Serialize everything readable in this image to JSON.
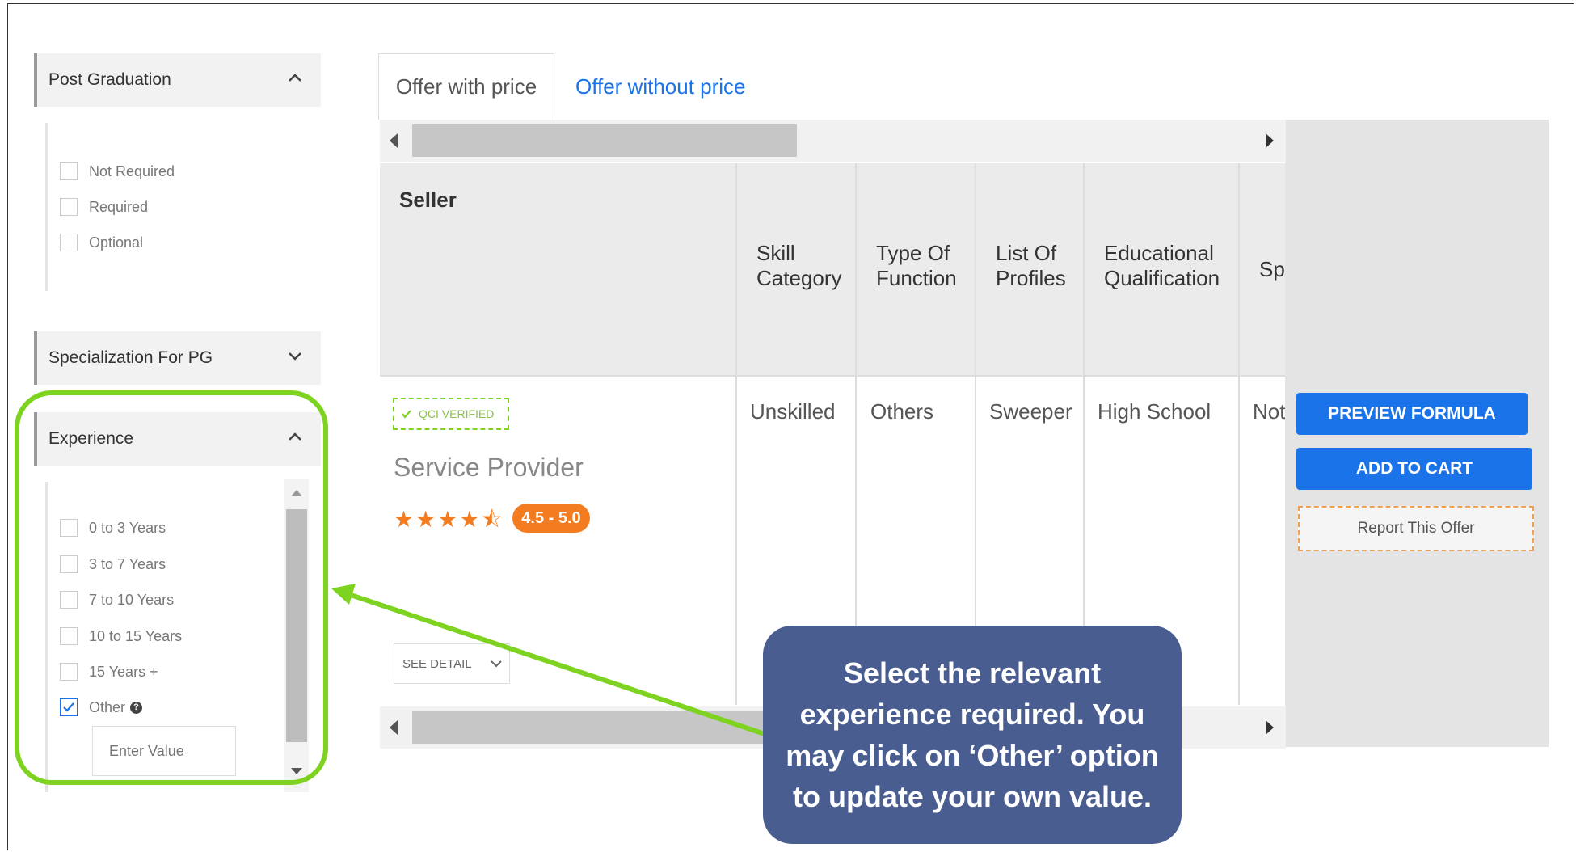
{
  "filters": {
    "post_graduation": {
      "title": "Post Graduation",
      "options": [
        "Not Required",
        "Required",
        "Optional"
      ]
    },
    "specialization": {
      "title": "Specialization For PG"
    },
    "experience": {
      "title": "Experience",
      "options": [
        "0 to 3 Years",
        "3 to 7 Years",
        "7 to 10 Years",
        "10 to 15 Years",
        "15 Years +",
        "Other"
      ],
      "checked": "Other",
      "other_placeholder": "Enter Value"
    }
  },
  "tabs": [
    "Offer with price",
    "Offer without price"
  ],
  "table": {
    "headers": {
      "seller": "Seller",
      "skill_1": "Skill",
      "skill_2": "Category",
      "type_1": "Type Of",
      "type_2": "Function",
      "list_1": "List Of",
      "list_2": "Profiles",
      "edu_1": "Educational",
      "edu_2": "Qualification",
      "cut": "Sp"
    },
    "row": {
      "badge": "QCI VERIFIED",
      "seller_name": "Service Provider",
      "stars": "★★★★⯪",
      "rating": "4.5 - 5.0",
      "skill_category": "Unskilled",
      "type_of_function": "Others",
      "list_of_profiles": "Sweeper",
      "educational_qualification": "High School",
      "cut_value": "Not",
      "see_detail": "SEE DETAIL"
    }
  },
  "actions": {
    "preview": "PREVIEW FORMULA",
    "add_to_cart": "ADD TO CART",
    "report": "Report This Offer"
  },
  "callout": "Select the relevant experience required. You may click on ‘Other’ option to update your own value.",
  "colors": {
    "highlight": "#7ed321",
    "callout_bg": "#4a5d91",
    "primary": "#1a73e8",
    "rating": "#f47c20"
  }
}
